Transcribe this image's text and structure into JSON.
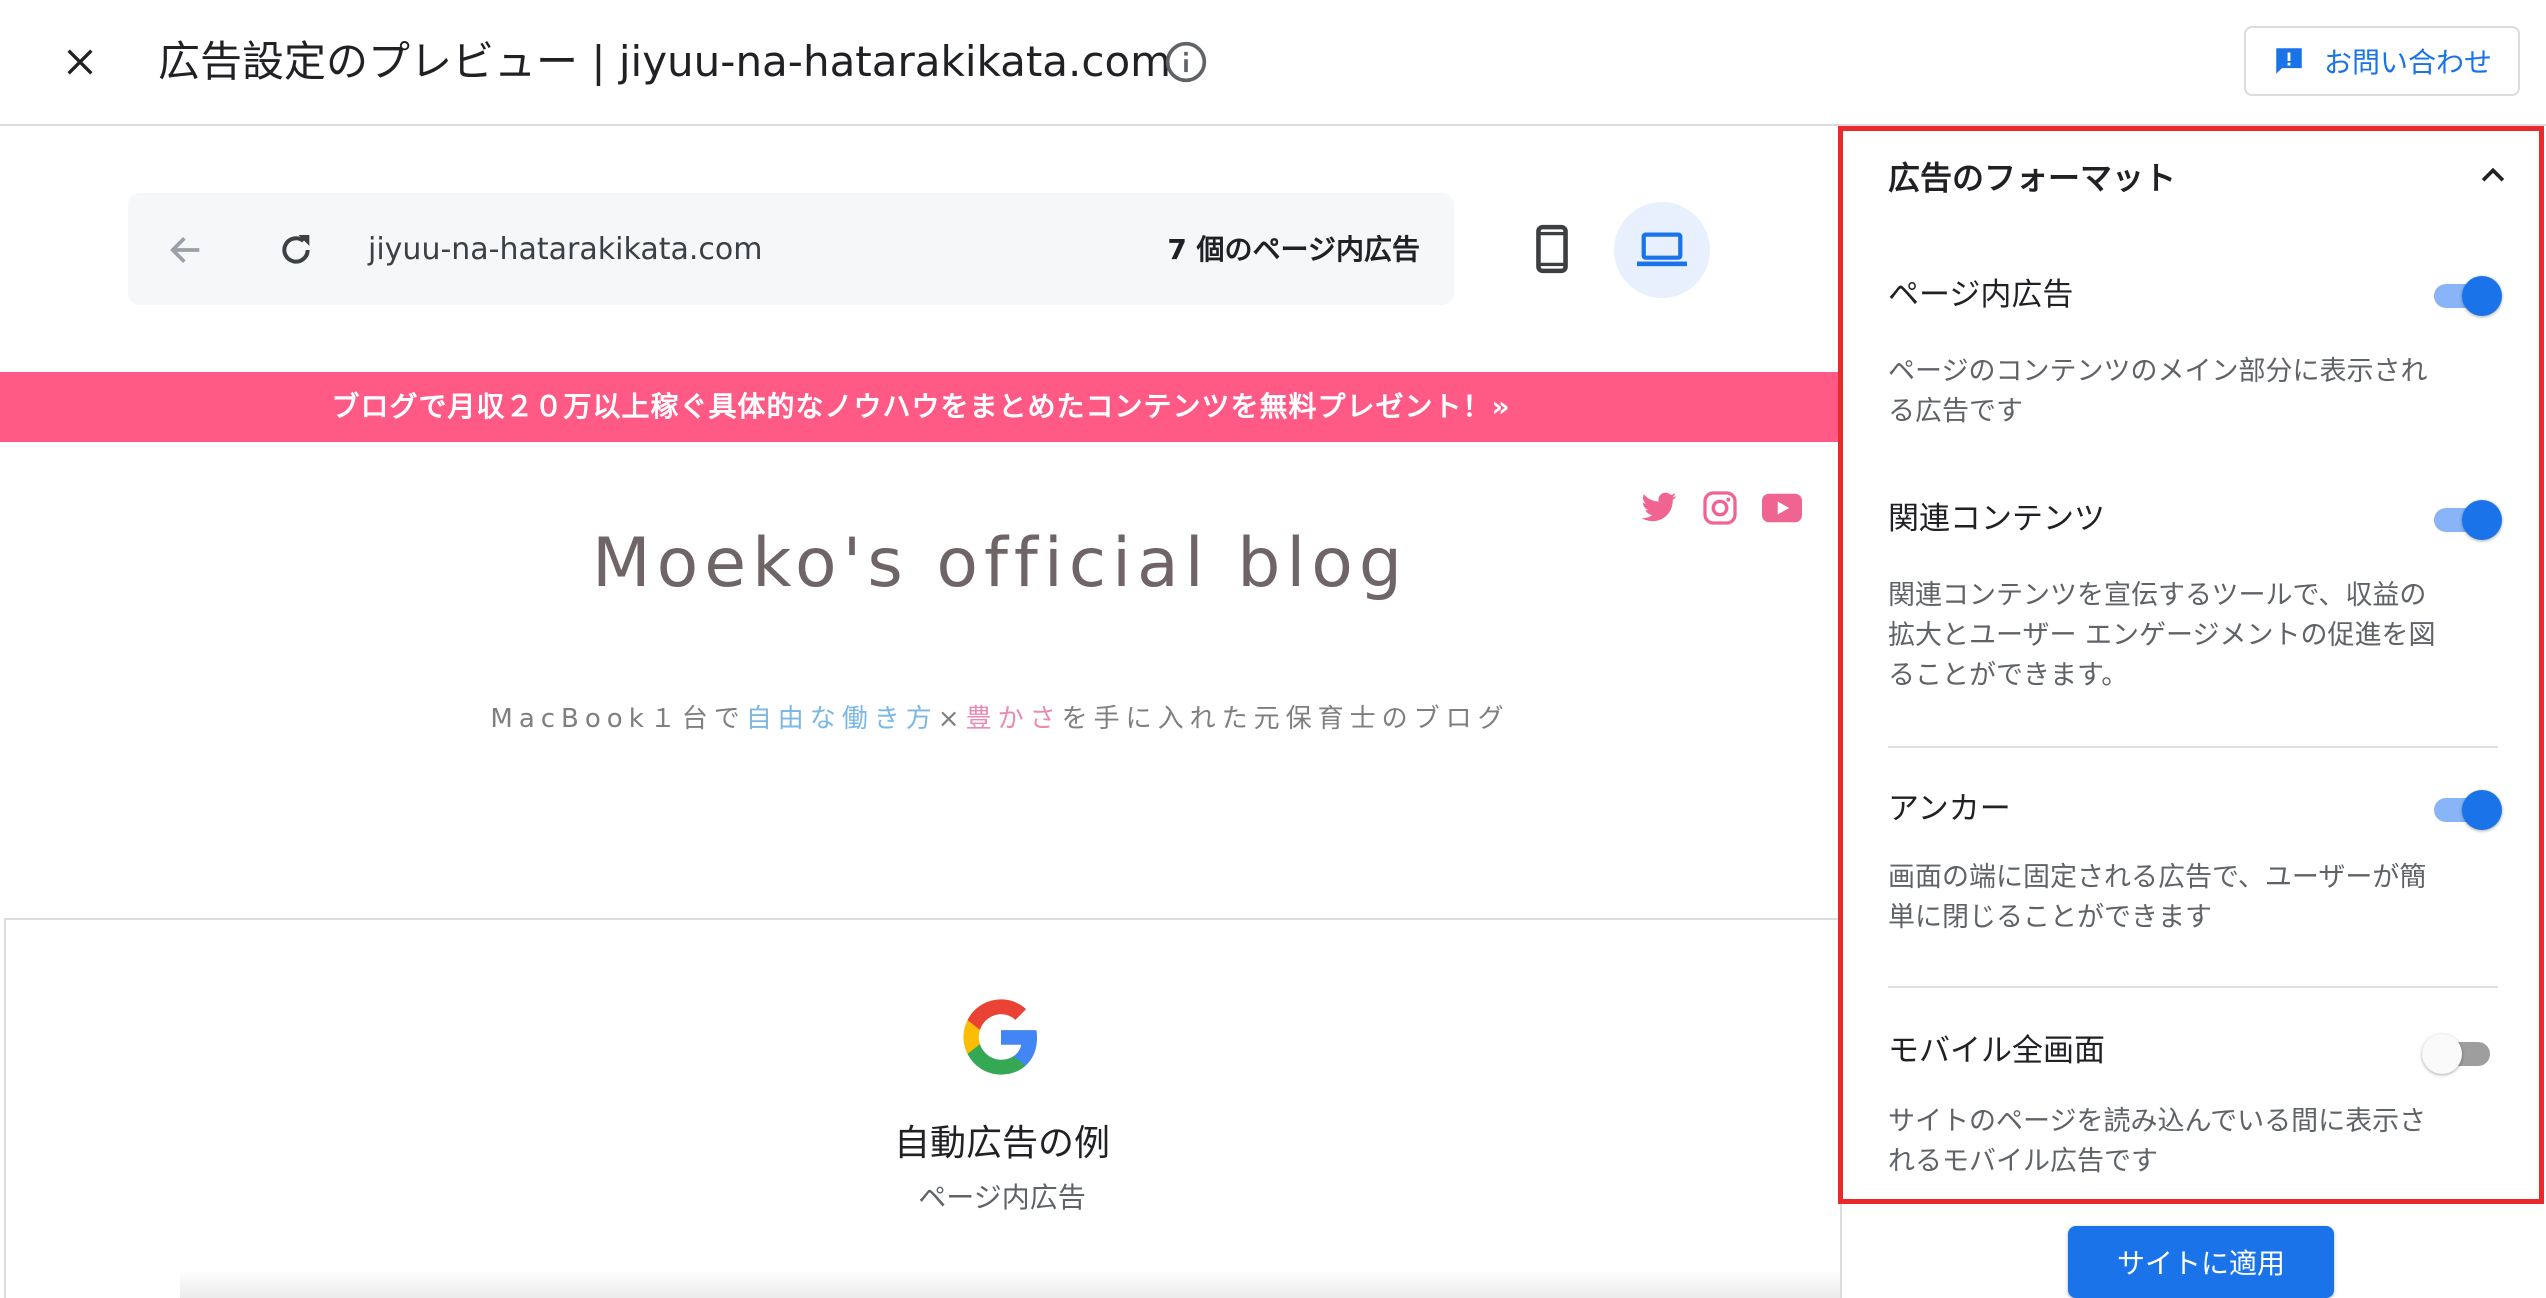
{
  "header": {
    "title": "広告設定のプレビュー | jiyuu-na-hatarakikata.com",
    "contact_label": "お問い合わせ"
  },
  "browser": {
    "url": "jiyuu-na-hatarakikata.com",
    "ad_count": "7 個のページ内広告"
  },
  "preview": {
    "promo_banner": "ブログで月収２０万以上稼ぐ具体的なノウハウをまとめたコンテンツを無料プレゼント！»",
    "blog_title": "Moeko's official blog",
    "tagline": {
      "part1": "MacBook１台で",
      "part2": "自由な働き方",
      "sep": "×",
      "part3": "豊かさ",
      "part4": "を手に入れた元保育士のブログ"
    },
    "ad_example_title": "自動広告の例",
    "ad_example_sub": "ページ内広告"
  },
  "panel": {
    "section_title": "広告のフォーマット",
    "options": [
      {
        "title": "ページ内広告",
        "desc": "ページのコンテンツのメイン部分に表示される広告です",
        "enabled": true
      },
      {
        "title": "関連コンテンツ",
        "desc": "関連コンテンツを宣伝するツールで、収益の拡大とユーザー エンゲージメントの促進を図ることができます。",
        "enabled": true
      },
      {
        "title": "アンカー",
        "desc": "画面の端に固定される広告で、ユーザーが簡単に閉じることができます",
        "enabled": true
      },
      {
        "title": "モバイル全画面",
        "desc": "サイトのページを読み込んでいる間に表示されるモバイル広告です",
        "enabled": false
      }
    ],
    "apply_label": "サイトに適用"
  },
  "colors": {
    "accent": "#1a73e8",
    "promo": "#ff5a85",
    "highlight_frame": "#ea2a2a",
    "social": "#f06491"
  },
  "icons": [
    "close-icon",
    "info-icon",
    "feedback-icon",
    "back-arrow-icon",
    "reload-icon",
    "smartphone-icon",
    "laptop-icon",
    "twitter-icon",
    "instagram-icon",
    "youtube-icon",
    "google-g-icon",
    "chevron-up-icon"
  ]
}
